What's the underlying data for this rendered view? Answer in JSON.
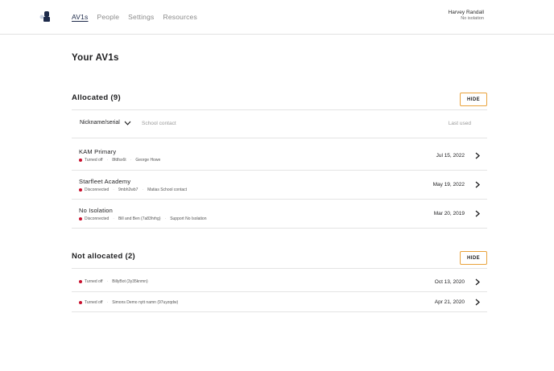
{
  "header": {
    "nav": [
      "AV1s",
      "People",
      "Settings",
      "Resources"
    ],
    "user_name": "Harvey Randall",
    "user_subtitle": "No isolation"
  },
  "page_title": "Your AV1s",
  "allocated": {
    "title": "Allocated (9)",
    "hide_label": "HIDE",
    "filter": {
      "select_value": "Nickname/serial",
      "contact_label": "School contact",
      "last_used_label": "Last used"
    },
    "rows": [
      {
        "name": "KAM Primary",
        "status": "Turned off",
        "serial": "8fdfsx6t",
        "contact": "George Howe",
        "date": "Jul 15, 2022"
      },
      {
        "name": "Starfleet Academy",
        "status": "Disconnected",
        "serial": "9mbh2wb7",
        "contact": "Matias School contact",
        "date": "May 19, 2022"
      },
      {
        "name": "No Isolation",
        "status": "Disconnected",
        "serial": "Bill and Ben (7a83hrhg)",
        "contact": "Support No Isolation",
        "date": "Mar 20, 2019"
      }
    ]
  },
  "not_allocated": {
    "title": "Not allocated (2)",
    "hide_label": "HIDE",
    "rows": [
      {
        "status": "Turned off",
        "serial": "BillyBot (3y35knmn)",
        "date": "Oct 13, 2020"
      },
      {
        "status": "Turned off",
        "serial": "Simons Demo nytt namn (97uyzqdw)",
        "date": "Apr 21, 2020"
      }
    ]
  },
  "colors": {
    "accent": "#e9a23b",
    "status_dot": "#c8102e",
    "nav_active": "#1d2a4a"
  },
  "icons": {
    "logo": "av1-logo-icon",
    "row_chevron": "chevron-right-icon",
    "select_chevron": "chevron-down-icon"
  }
}
